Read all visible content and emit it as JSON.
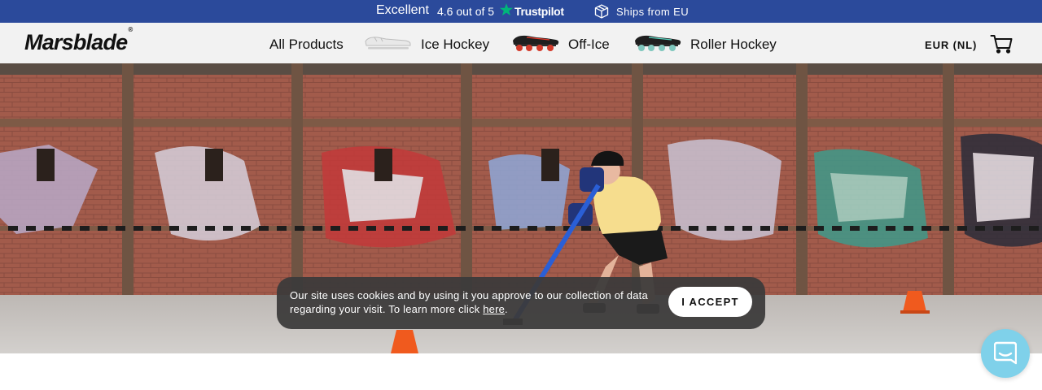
{
  "topbar": {
    "trustpilot_label": "Excellent",
    "trustpilot_score": "4.6 out of 5",
    "trustpilot_brand": "Trustpilot",
    "shipping_text": "Ships from EU",
    "icons": [
      "trustpilot-star-icon",
      "package-icon"
    ],
    "colors": {
      "background": "#2b4a9b",
      "star": "#00b67a"
    }
  },
  "header": {
    "logo_text": "Marsblade",
    "logo_mark": "®",
    "nav": [
      {
        "label": "All Products"
      },
      {
        "label": "Ice Hockey",
        "thumbnail": "ice-skate-thumbnail"
      },
      {
        "label": "Off-Ice",
        "thumbnail": "off-ice-skate-thumbnail"
      },
      {
        "label": "Roller Hockey",
        "thumbnail": "roller-skate-thumbnail"
      }
    ],
    "currency": "EUR (NL)",
    "cart_icon": "cart-icon"
  },
  "hero": {
    "image": "roller-hockey-player-graffiti-wall",
    "colors": {
      "brick": "#9e5a4a",
      "floor": "#c9c5c2",
      "cone": "#f05a1e"
    }
  },
  "cookie_banner": {
    "text": "Our site uses cookies and by using it you approve to our collection of data regarding your visit. To learn more click ",
    "link_text": "here",
    "text_end": ".",
    "accept_label": "I ACCEPT"
  },
  "chat_widget": {
    "icon": "chat-bubble-icon",
    "color": "#7fd1ea"
  }
}
